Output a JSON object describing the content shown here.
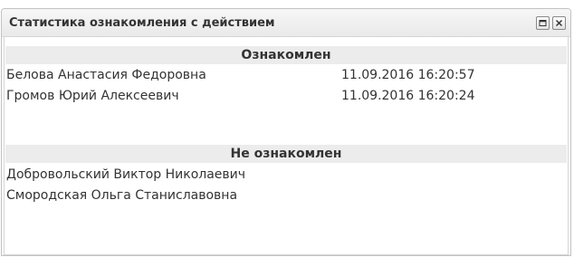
{
  "window": {
    "title": "Статистика ознакомления с действием",
    "controls": {
      "maximize_icon": "maximize-icon",
      "close_icon": "close-icon"
    }
  },
  "acquainted": {
    "header": "Ознакомлен",
    "rows": [
      {
        "name": "Белова Анастасия Федоровна",
        "date": "11.09.2016 16:20:57"
      },
      {
        "name": "Громов Юрий Алексеевич",
        "date": "11.09.2016 16:20:24"
      }
    ]
  },
  "not_acquainted": {
    "header": "Не ознакомлен",
    "rows": [
      {
        "name": "Добровольский Виктор Николаевич"
      },
      {
        "name": "Смородская Ольга Станиславовна"
      }
    ]
  }
}
